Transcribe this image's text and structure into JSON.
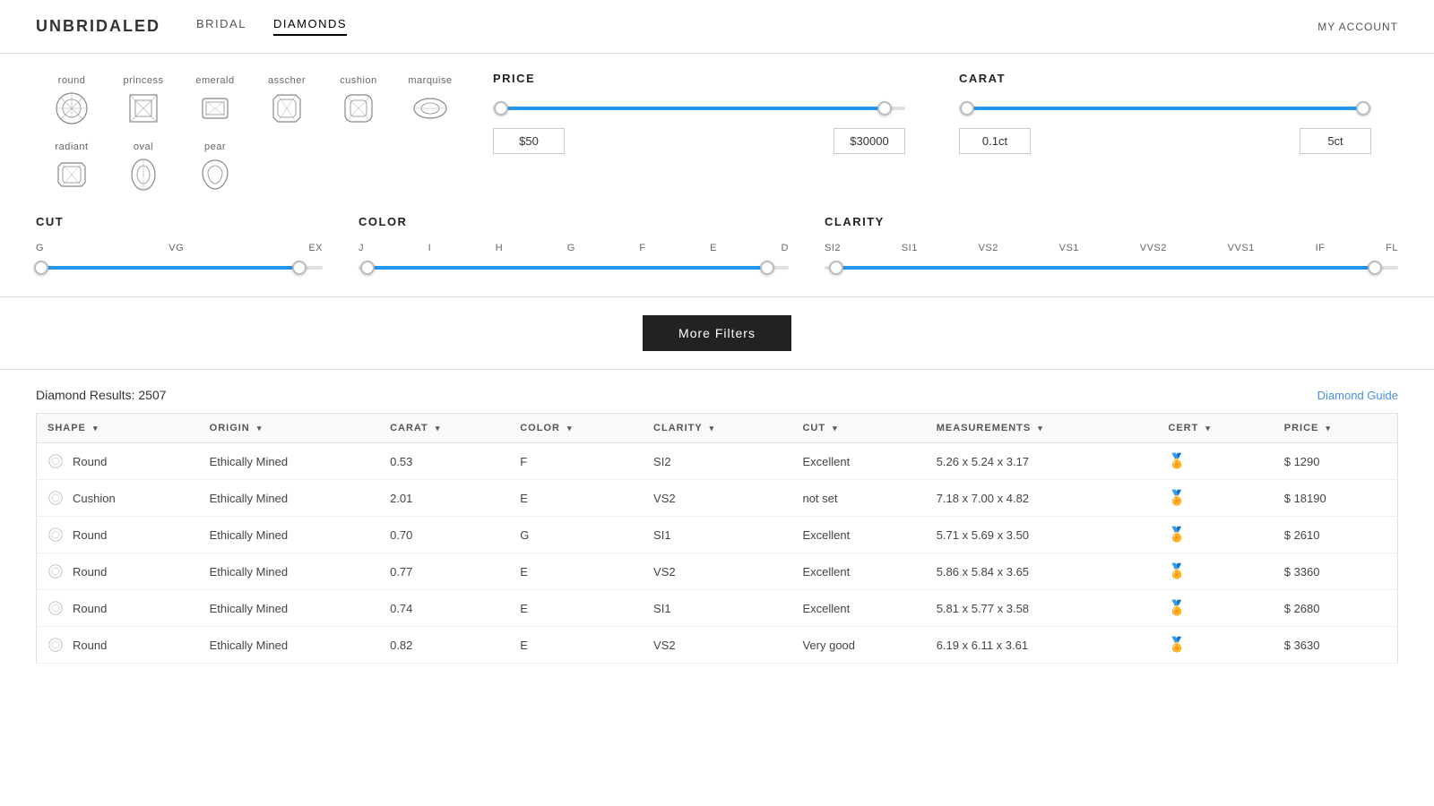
{
  "header": {
    "logo": "UNBRIDALED",
    "nav": [
      {
        "label": "BRIDAL",
        "active": false
      },
      {
        "label": "DIAMONDS",
        "active": true
      }
    ],
    "my_account": "MY ACCOUNT"
  },
  "shapes": [
    {
      "label": "round",
      "id": "round"
    },
    {
      "label": "princess",
      "id": "princess"
    },
    {
      "label": "emerald",
      "id": "emerald"
    },
    {
      "label": "asscher",
      "id": "asscher"
    },
    {
      "label": "cushion",
      "id": "cushion"
    },
    {
      "label": "marquise",
      "id": "marquise"
    },
    {
      "label": "radiant",
      "id": "radiant"
    },
    {
      "label": "oval",
      "id": "oval"
    },
    {
      "label": "pear",
      "id": "pear"
    }
  ],
  "price_filter": {
    "title": "PRICE",
    "min": "$50",
    "max": "$30000",
    "fill_left_pct": "2",
    "fill_right_pct": "95"
  },
  "carat_filter": {
    "title": "CARAT",
    "min": "0.1ct",
    "max": "5ct",
    "fill_left_pct": "2",
    "fill_right_pct": "98"
  },
  "cut_filter": {
    "title": "CUT",
    "labels": [
      "G",
      "VG",
      "EX"
    ],
    "fill_left_pct": "2",
    "fill_right_pct": "92"
  },
  "color_filter": {
    "title": "COLOR",
    "labels": [
      "J",
      "I",
      "H",
      "G",
      "F",
      "E",
      "D"
    ],
    "fill_left_pct": "2",
    "fill_right_pct": "95"
  },
  "clarity_filter": {
    "title": "CLARITY",
    "labels": [
      "SI2",
      "SI1",
      "VS2",
      "VS1",
      "VVS2",
      "VVS1",
      "IF",
      "FL"
    ],
    "fill_left_pct": "2",
    "fill_right_pct": "96"
  },
  "more_filters_btn": "More Filters",
  "results": {
    "count_label": "Diamond Results: 2507",
    "guide_link": "Diamond Guide",
    "columns": [
      {
        "label": "SHAPE"
      },
      {
        "label": "ORIGIN"
      },
      {
        "label": "CARAT"
      },
      {
        "label": "COLOR"
      },
      {
        "label": "CLARITY"
      },
      {
        "label": "CUT"
      },
      {
        "label": "MEASUREMENTS"
      },
      {
        "label": "CERT"
      },
      {
        "label": "PRICE"
      }
    ],
    "rows": [
      {
        "shape": "Round",
        "origin": "Ethically Mined",
        "carat": "0.53",
        "color": "F",
        "clarity": "SI2",
        "cut": "Excellent",
        "measurements": "5.26 x 5.24 x 3.17",
        "price": "$ 1290"
      },
      {
        "shape": "Cushion",
        "origin": "Ethically Mined",
        "carat": "2.01",
        "color": "E",
        "clarity": "VS2",
        "cut": "not set",
        "measurements": "7.18 x 7.00 x 4.82",
        "price": "$ 18190"
      },
      {
        "shape": "Round",
        "origin": "Ethically Mined",
        "carat": "0.70",
        "color": "G",
        "clarity": "SI1",
        "cut": "Excellent",
        "measurements": "5.71 x 5.69 x 3.50",
        "price": "$ 2610"
      },
      {
        "shape": "Round",
        "origin": "Ethically Mined",
        "carat": "0.77",
        "color": "E",
        "clarity": "VS2",
        "cut": "Excellent",
        "measurements": "5.86 x 5.84 x 3.65",
        "price": "$ 3360"
      },
      {
        "shape": "Round",
        "origin": "Ethically Mined",
        "carat": "0.74",
        "color": "E",
        "clarity": "SI1",
        "cut": "Excellent",
        "measurements": "5.81 x 5.77 x 3.58",
        "price": "$ 2680"
      },
      {
        "shape": "Round",
        "origin": "Ethically Mined",
        "carat": "0.82",
        "color": "E",
        "clarity": "VS2",
        "cut": "Very good",
        "measurements": "6.19 x 6.11 x 3.61",
        "price": "$ 3630"
      }
    ]
  }
}
